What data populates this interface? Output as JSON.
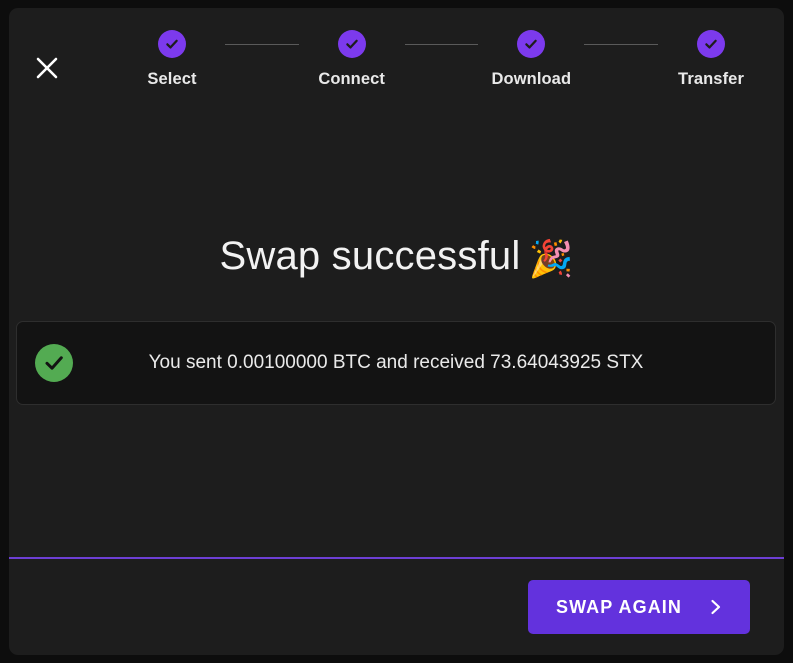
{
  "dialog": {
    "close_icon": "close-icon",
    "accent_color": "#7c3aed",
    "button_color": "#6332dd",
    "success_color": "#53ab52",
    "divider_color": "#6d3fd4",
    "background_color": "#1d1d1d"
  },
  "stepper": {
    "steps": [
      {
        "label": "Select",
        "state": "complete",
        "icon": "check-icon"
      },
      {
        "label": "Connect",
        "state": "complete",
        "icon": "check-icon"
      },
      {
        "label": "Download",
        "state": "complete",
        "icon": "check-icon"
      },
      {
        "label": "Transfer",
        "state": "complete",
        "icon": "check-icon"
      }
    ]
  },
  "main": {
    "title": "Swap successful",
    "title_emoji": "🎉",
    "result": {
      "icon": "check-circle-icon",
      "message": "You sent 0.00100000 BTC and received 73.64043925 STX",
      "sent_amount": "0.00100000",
      "sent_currency": "BTC",
      "received_amount": "73.64043925",
      "received_currency": "STX"
    }
  },
  "footer": {
    "swap_again_label": "SWAP AGAIN",
    "swap_again_icon": "chevron-right-icon"
  }
}
